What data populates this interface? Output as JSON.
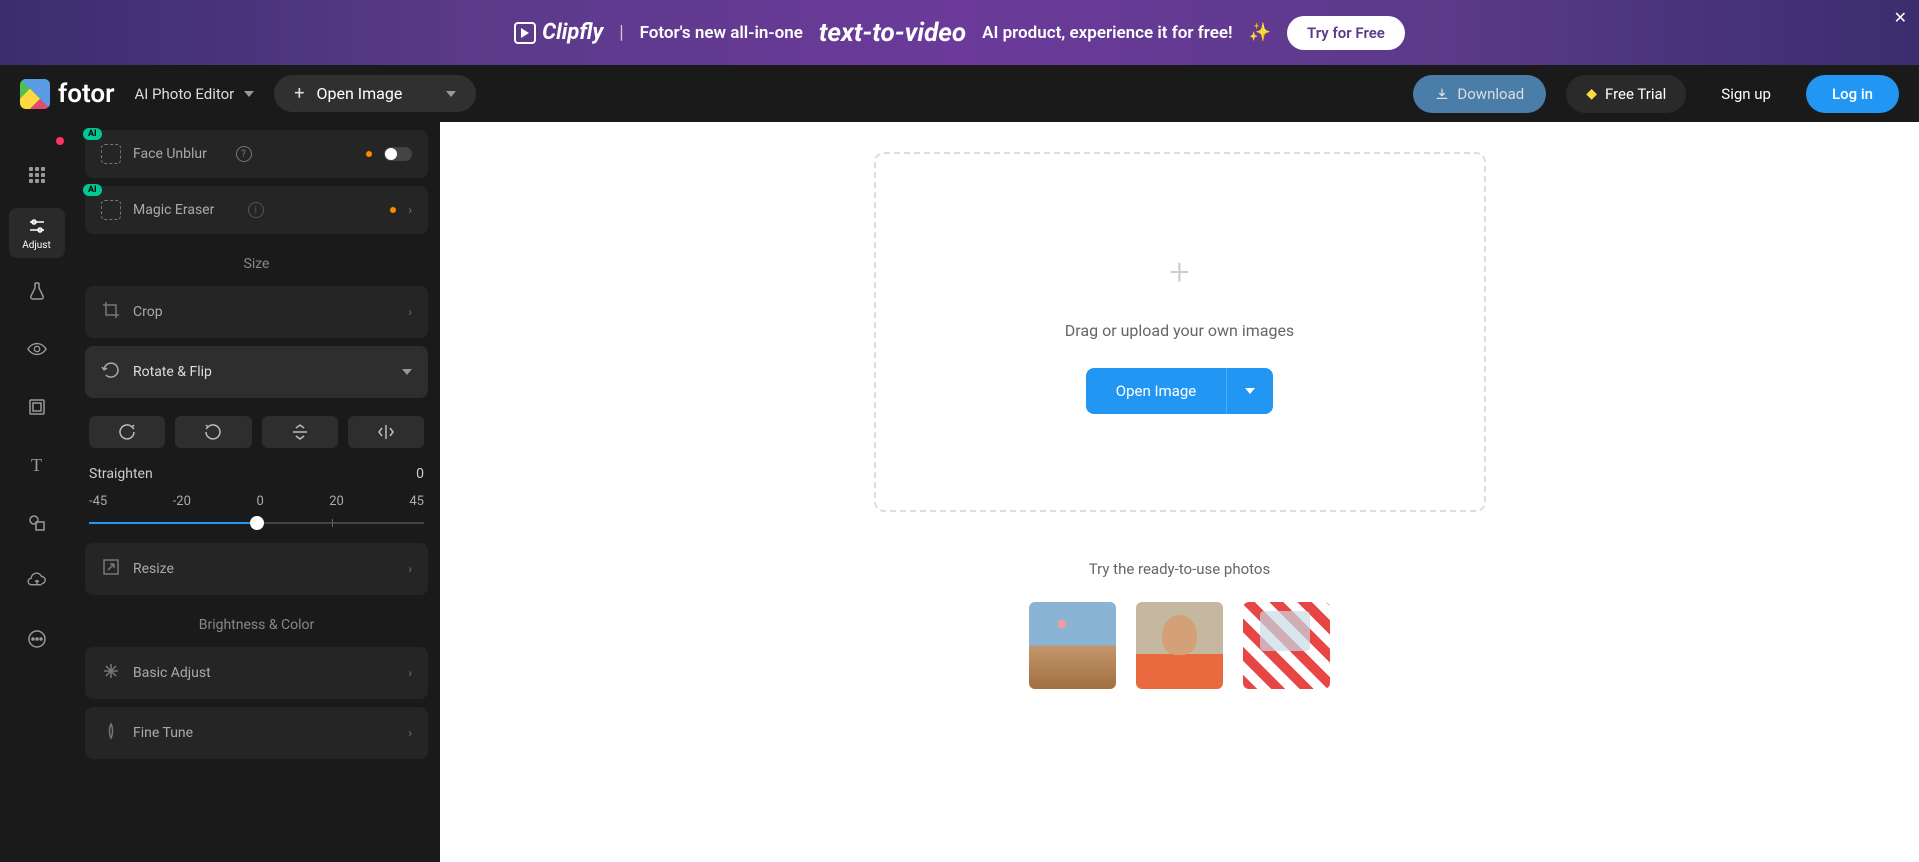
{
  "banner": {
    "logo": "Clipfly",
    "text_before": "Fotor's new all-in-one",
    "highlight": "text-to-video",
    "text_after": "AI product, experience it for free!",
    "sparkle": "✨",
    "cta": "Try for Free"
  },
  "header": {
    "brand": "fotor",
    "editor_mode": "AI Photo Editor",
    "open_image": "Open Image",
    "download": "Download",
    "free_trial": "Free Trial",
    "signup": "Sign up",
    "login": "Log in"
  },
  "nav": {
    "adjust": "Adjust"
  },
  "panel": {
    "face_unblur": "Face Unblur",
    "magic_eraser": "Magic Eraser",
    "size_header": "Size",
    "crop": "Crop",
    "rotate_flip": "Rotate & Flip",
    "straighten_label": "Straighten",
    "straighten_value": "0",
    "ticks": {
      "m45": "-45",
      "m20": "-20",
      "zero": "0",
      "p20": "20",
      "p45": "45"
    },
    "resize": "Resize",
    "brightness_header": "Brightness & Color",
    "basic_adjust": "Basic Adjust",
    "fine_tune": "Fine Tune"
  },
  "canvas": {
    "drop_text": "Drag or upload your own images",
    "open_image": "Open Image",
    "try_text": "Try the ready-to-use photos"
  }
}
